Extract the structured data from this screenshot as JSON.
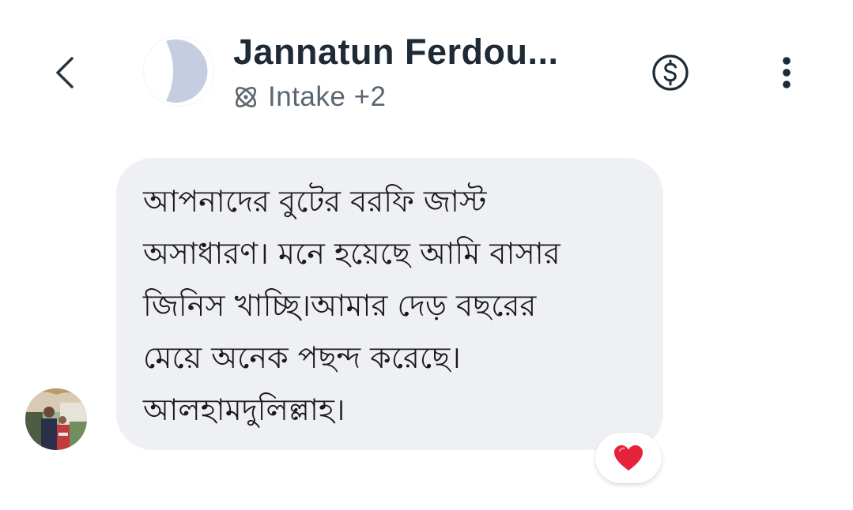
{
  "header": {
    "back_icon": "chevron-left-icon",
    "contact_name": "Jannatun Ferdou...",
    "label_icon": "atom-icon",
    "labels_text": "Intake +2",
    "payment_icon": "dollar-circle-icon",
    "more_icon": "more-vertical-icon"
  },
  "message": {
    "lines": [
      "আপনাদের বুটের বরফি জাস্ট",
      "অসাধারণ। মনে হয়েছে আমি বাসার",
      "জিনিস খাচ্ছি।আমার দেড় বছরের",
      "মেয়ে অনেক পছন্দ করেছে।",
      "আলহামদুলিল্লাহ।"
    ],
    "reaction": "❤️",
    "bubble_color": "#eff0f4"
  },
  "colors": {
    "title": "#1e2a36",
    "subtitle": "#5b6670",
    "heart": "#e4233a",
    "avatar_placeholder": "#c7cde0"
  }
}
